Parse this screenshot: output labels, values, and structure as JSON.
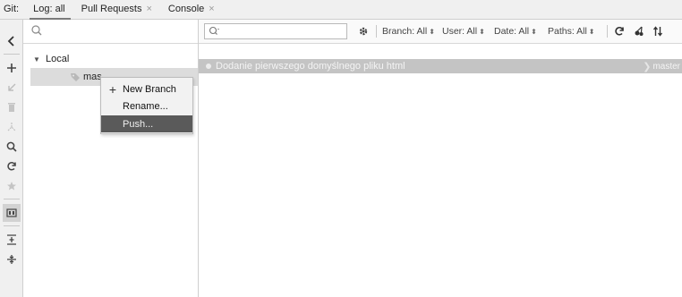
{
  "tabbar": {
    "git_label": "Git:",
    "tabs": [
      {
        "label": "Log: all",
        "closable": false
      },
      {
        "label": "Pull Requests",
        "closable": true
      },
      {
        "label": "Console",
        "closable": true
      }
    ],
    "close_glyph": "×"
  },
  "left_toolbar": {
    "icons": [
      "back-arrow-icon",
      "plus-icon",
      "checkout-arrow-icon",
      "trash-icon",
      "merge-arrows-icon",
      "search-icon",
      "refresh-icon",
      "star-icon",
      "branch-list-icon",
      "expand-all-icon",
      "collapse-all-icon"
    ]
  },
  "branches": {
    "search_placeholder": "",
    "local_label": "Local",
    "branch_label": "mas"
  },
  "context_menu": {
    "items": [
      {
        "label": "New Branch",
        "icon": "plus-icon"
      },
      {
        "label": "Rename..."
      },
      {
        "label": "Push...",
        "selected": true
      }
    ]
  },
  "log": {
    "search_value": "",
    "filters": {
      "branch": "Branch: All",
      "user": "User: All",
      "date": "Date: All",
      "paths": "Paths: All"
    },
    "commits": [
      {
        "message": "Dodanie pierwszego domyślnego pliku html",
        "ref": "master"
      }
    ]
  },
  "colors": {
    "selected_menu": "#5a5a5a",
    "commit_row": "#c4c4c4",
    "branch_row": "#dcdcdc"
  }
}
